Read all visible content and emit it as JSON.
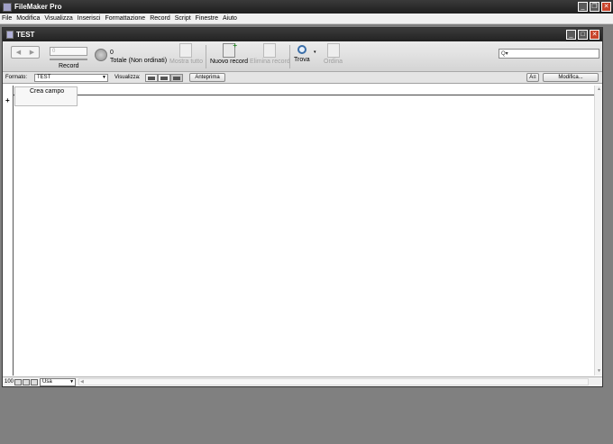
{
  "app": {
    "title": "FileMaker Pro"
  },
  "menubar": {
    "items": [
      "File",
      "Modifica",
      "Visualizza",
      "Inserisci",
      "Formattazione",
      "Record",
      "Script",
      "Finestre",
      "Aiuto"
    ]
  },
  "window": {
    "title": "TEST"
  },
  "toolbar": {
    "record_value": "0",
    "record_label": "Record",
    "found_count": "0",
    "total_label": "Totale (Non ordinati)",
    "show_all": "Mostra tutto",
    "new_record": "Nuovo record",
    "delete_record": "Elimina record",
    "find": "Trova",
    "sort": "Ordina",
    "search_icon_text": "Q▾"
  },
  "layoutbar": {
    "format_label": "Formato:",
    "format_value": "TEST",
    "view_label": "Visualizza:",
    "preview_button": "Anteprima",
    "font_button": "A≡",
    "edit_button": "Modifica..."
  },
  "content": {
    "create_field": "Crea campo",
    "add_row": "+"
  },
  "bottombar": {
    "zoom": "100",
    "mode_value": "Usa"
  }
}
